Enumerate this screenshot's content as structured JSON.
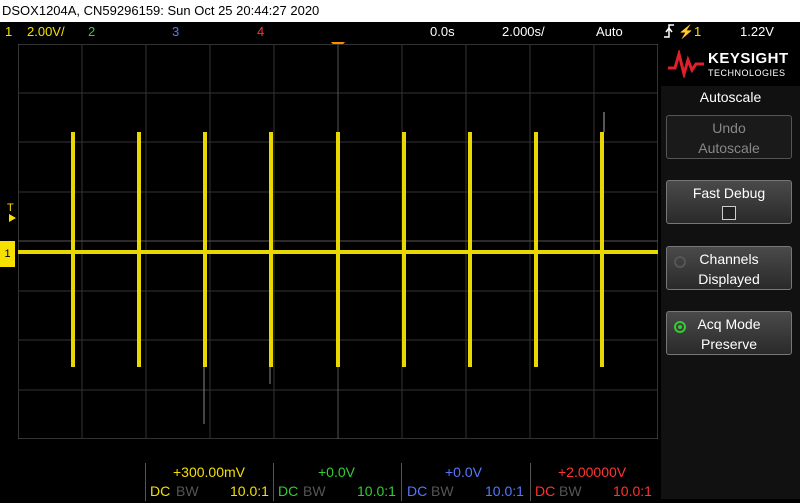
{
  "title_bar": {
    "text": "DSOX1204A, CN59296159: Sun Oct 25 20:44:27 2020"
  },
  "status_bar": {
    "ch1_num": "1",
    "ch1_scale": "2.00V/",
    "ch2_num": "2",
    "ch3_num": "3",
    "ch4_num": "4",
    "time_delay": "0.0s",
    "time_scale": "2.000s/",
    "trigger_mode": "Auto",
    "trigger_icon": "trigger-rising-edge-icon",
    "trigger_source": "1",
    "trigger_level": "1.22V"
  },
  "markers": {
    "trigger_level": "T",
    "ch1_ground": "1"
  },
  "softkeys": {
    "brand": "KEYSIGHT",
    "brand_sub": "TECHNOLOGIES",
    "menu_title": "Autoscale",
    "undo_l1": "Undo",
    "undo_l2": "Autoscale",
    "fast_debug": "Fast Debug",
    "channels_l1": "Channels",
    "channels_l2": "Displayed",
    "acq_l1": "Acq Mode",
    "acq_l2": "Preserve"
  },
  "channels": [
    {
      "offset": "+300.00mV",
      "coupling": "DC",
      "bw": "BW",
      "probe": "10.0:1",
      "color": "#f5e000"
    },
    {
      "offset": "+0.0V",
      "coupling": "DC",
      "bw": "BW",
      "probe": "10.0:1",
      "color": "#33cc33"
    },
    {
      "offset": "+0.0V",
      "coupling": "DC",
      "bw": "BW",
      "probe": "10.0:1",
      "color": "#5577ff"
    },
    {
      "offset": "+2.00000V",
      "coupling": "DC",
      "bw": "BW",
      "probe": "10.0:1",
      "color": "#ff3333"
    }
  ],
  "colors": {
    "ch1": "#f5e000",
    "ch2": "#33cc33",
    "ch3": "#5577ff",
    "ch4": "#ff3333",
    "trigger_marker": "#ff8c00"
  }
}
